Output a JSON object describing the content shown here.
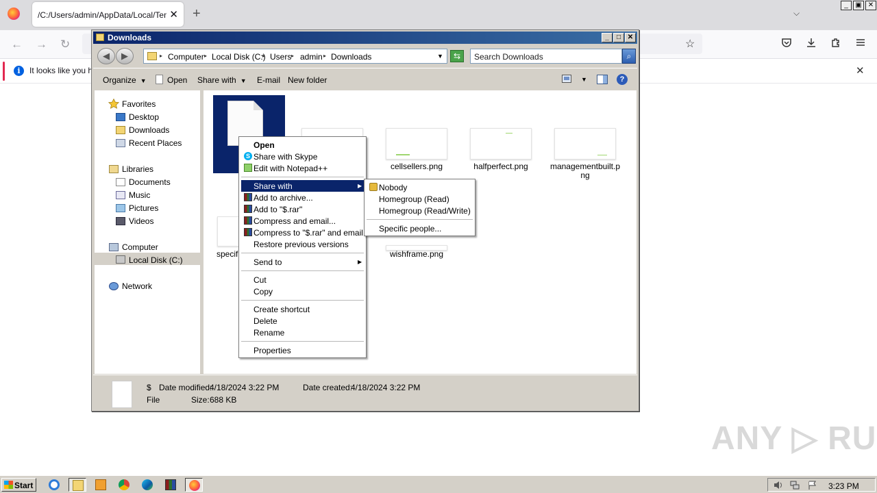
{
  "browser": {
    "tab_title": "/C:/Users/admin/AppData/Local/Temp/f",
    "tab_close": "✕",
    "new_tab": "+",
    "tab_list": "⌵",
    "back": "←",
    "forward": "→",
    "reload": "↻",
    "bookmark_star": "☆",
    "notification_text": "It looks like you ha",
    "notification_close": "✕",
    "window_controls": [
      "_",
      "▣",
      "✕"
    ]
  },
  "explorer": {
    "title": "Downloads",
    "window_controls": [
      "_",
      "□",
      "✕"
    ],
    "back": "◀",
    "forward": "▶",
    "breadcrumb": [
      "Computer",
      "Local Disk (C:)",
      "Users",
      "admin",
      "Downloads"
    ],
    "breadcrumb_sep": "▸",
    "search_placeholder": "Search Downloads",
    "search_icon": "⌕",
    "refresh_icon": "⇆",
    "toolbar": {
      "organize": "Organize",
      "open": "Open",
      "share_with": "Share with",
      "email": "E-mail",
      "new_folder": "New folder",
      "caret": "▼",
      "help": "?"
    },
    "nav": {
      "favorites": "Favorites",
      "desktop": "Desktop",
      "downloads": "Downloads",
      "recent_places": "Recent Places",
      "libraries": "Libraries",
      "documents": "Documents",
      "music": "Music",
      "pictures": "Pictures",
      "videos": "Videos",
      "computer": "Computer",
      "local_disk": "Local Disk (C:)",
      "network": "Network"
    },
    "files": {
      "cellsellers": "cellsellers.png",
      "halfperfect": "halfperfect.png",
      "managementbuilt_1": "managementbuilt.p",
      "managementbuilt_2": "ng",
      "specific_partial": "specifi",
      "wishframe": "wishframe.png"
    },
    "details": {
      "name": "$",
      "type": "File",
      "date_modified_label": "Date modified:",
      "date_modified": "4/18/2024 3:22 PM",
      "date_created_label": "Date created:",
      "date_created": "4/18/2024 3:22 PM",
      "size_label": "Size:",
      "size": "688 KB"
    }
  },
  "context_menu": {
    "open": "Open",
    "share_skype": "Share with Skype",
    "edit_notepad": "Edit with Notepad++",
    "share_with": "Share with",
    "add_archive": "Add to archive...",
    "add_rar": "Add to \"$.rar\"",
    "compress_email": "Compress and email...",
    "compress_rar_email": "Compress to \"$.rar\" and email",
    "restore": "Restore previous versions",
    "send_to": "Send to",
    "cut": "Cut",
    "copy": "Copy",
    "create_shortcut": "Create shortcut",
    "delete": "Delete",
    "rename": "Rename",
    "properties": "Properties",
    "arrow": "▶",
    "skype_letter": "S"
  },
  "share_submenu": {
    "nobody": "Nobody",
    "homegroup_read": "Homegroup (Read)",
    "homegroup_rw": "Homegroup (Read/Write)",
    "specific_people": "Specific people..."
  },
  "taskbar": {
    "start": "Start",
    "clock": "3:23 PM"
  },
  "watermark": "ANY ▷ RUN",
  "colors": {
    "title_bar": "#0a246a",
    "selection": "#0a246a",
    "firefox_accent": "#ff7139",
    "notification_accent": "#e22850"
  }
}
